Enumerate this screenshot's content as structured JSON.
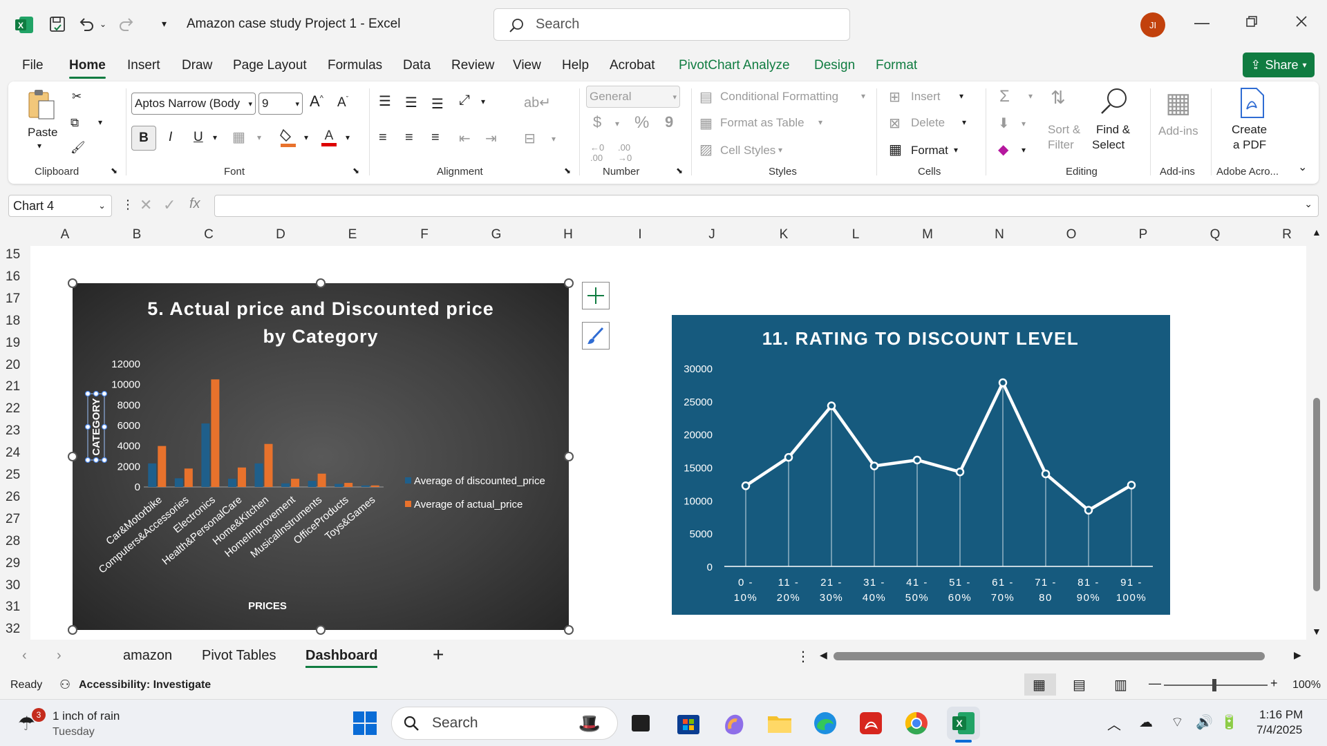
{
  "window": {
    "title": "Amazon case study Project 1  -  Excel",
    "search_placeholder": "Search",
    "avatar_initials": "JI"
  },
  "ribbon_tabs": [
    "File",
    "Home",
    "Insert",
    "Draw",
    "Page Layout",
    "Formulas",
    "Data",
    "Review",
    "View",
    "Help",
    "Acrobat",
    "PivotChart Analyze",
    "Design",
    "Format"
  ],
  "share_label": "Share",
  "ribbon": {
    "clipboard": {
      "paste": "Paste",
      "label": "Clipboard"
    },
    "font": {
      "name": "Aptos Narrow (Body",
      "size": "9",
      "bold": "B",
      "italic": "I",
      "underline": "U",
      "label": "Font"
    },
    "alignment": {
      "label": "Alignment"
    },
    "number": {
      "format": "General",
      "currency": "$",
      "percent": "%",
      "comma": "9",
      "label": "Number"
    },
    "styles": {
      "conditional": "Conditional Formatting",
      "format_table": "Format as Table",
      "cell_styles": "Cell Styles",
      "label": "Styles"
    },
    "cells": {
      "insert": "Insert",
      "delete": "Delete",
      "format": "Format",
      "label": "Cells"
    },
    "editing": {
      "sort_filter_1": "Sort &",
      "sort_filter_2": "Filter",
      "find_select_1": "Find &",
      "find_select_2": "Select",
      "label": "Editing"
    },
    "addins": {
      "btn": "Add-ins",
      "label": "Add-ins"
    },
    "adobe": {
      "create_1": "Create",
      "create_2": "a PDF",
      "label": "Adobe Acro..."
    }
  },
  "formula_bar": {
    "name_box": "Chart 4",
    "fx": "fx"
  },
  "columns": [
    "A",
    "B",
    "C",
    "D",
    "E",
    "F",
    "G",
    "H",
    "I",
    "J",
    "K",
    "L",
    "M",
    "N",
    "O",
    "P",
    "Q",
    "R"
  ],
  "rows": [
    "15",
    "16",
    "17",
    "18",
    "19",
    "20",
    "21",
    "22",
    "23",
    "24",
    "25",
    "26",
    "27",
    "28",
    "29",
    "30",
    "31",
    "32"
  ],
  "chart_data": [
    {
      "type": "bar",
      "title_line1": "5. Actual price and Discounted price",
      "title_line2": "by Category",
      "xlabel": "PRICES",
      "ylabel": "CATEGORY",
      "ylim": [
        0,
        12000
      ],
      "yticks": [
        "0",
        "2000",
        "4000",
        "6000",
        "8000",
        "10000",
        "12000"
      ],
      "categories": [
        "Car&Motorbike",
        "Computers&Accessories",
        "Electronics",
        "Health&PersonalCare",
        "Home&Kitchen",
        "HomeImprovement",
        "MusicalInstruments",
        "OfficeProducts",
        "Toys&Games"
      ],
      "series": [
        {
          "name": "Average of discounted_price",
          "color": "#1f5f8b",
          "values": [
            2300,
            850,
            6200,
            800,
            2300,
            350,
            600,
            300,
            150
          ]
        },
        {
          "name": "Average of actual_price",
          "color": "#e8722c",
          "values": [
            4000,
            1800,
            10500,
            1900,
            4200,
            800,
            1300,
            400,
            150
          ]
        }
      ],
      "legend": "right",
      "grid": false
    },
    {
      "type": "line",
      "title": "11. RATING TO DISCOUNT LEVEL",
      "ylim": [
        0,
        30000
      ],
      "yticks": [
        "0",
        "5000",
        "10000",
        "15000",
        "20000",
        "25000",
        "30000"
      ],
      "categories": [
        [
          "0 -",
          "10%"
        ],
        [
          "11 -",
          "20%"
        ],
        [
          "21 -",
          "30%"
        ],
        [
          "31 -",
          "40%"
        ],
        [
          "41 -",
          "50%"
        ],
        [
          "51 -",
          "60%"
        ],
        [
          "61 -",
          "70%"
        ],
        [
          "71 -",
          "80"
        ],
        [
          "81 -",
          "90%"
        ],
        [
          "91 -",
          "100%"
        ]
      ],
      "values": [
        12200,
        16500,
        24300,
        15200,
        16100,
        14300,
        27800,
        14000,
        8500,
        12300
      ],
      "grid": false
    }
  ],
  "sheet_tabs": [
    "amazon",
    "Pivot Tables",
    "Dashboard"
  ],
  "status": {
    "ready": "Ready",
    "accessibility": "Accessibility: Investigate",
    "zoom": "100%"
  },
  "taskbar": {
    "weather_title": "1 inch of rain",
    "weather_sub": "Tuesday",
    "weather_badge": "3",
    "search": "Search",
    "time": "1:16 PM",
    "date": "7/4/2025"
  }
}
